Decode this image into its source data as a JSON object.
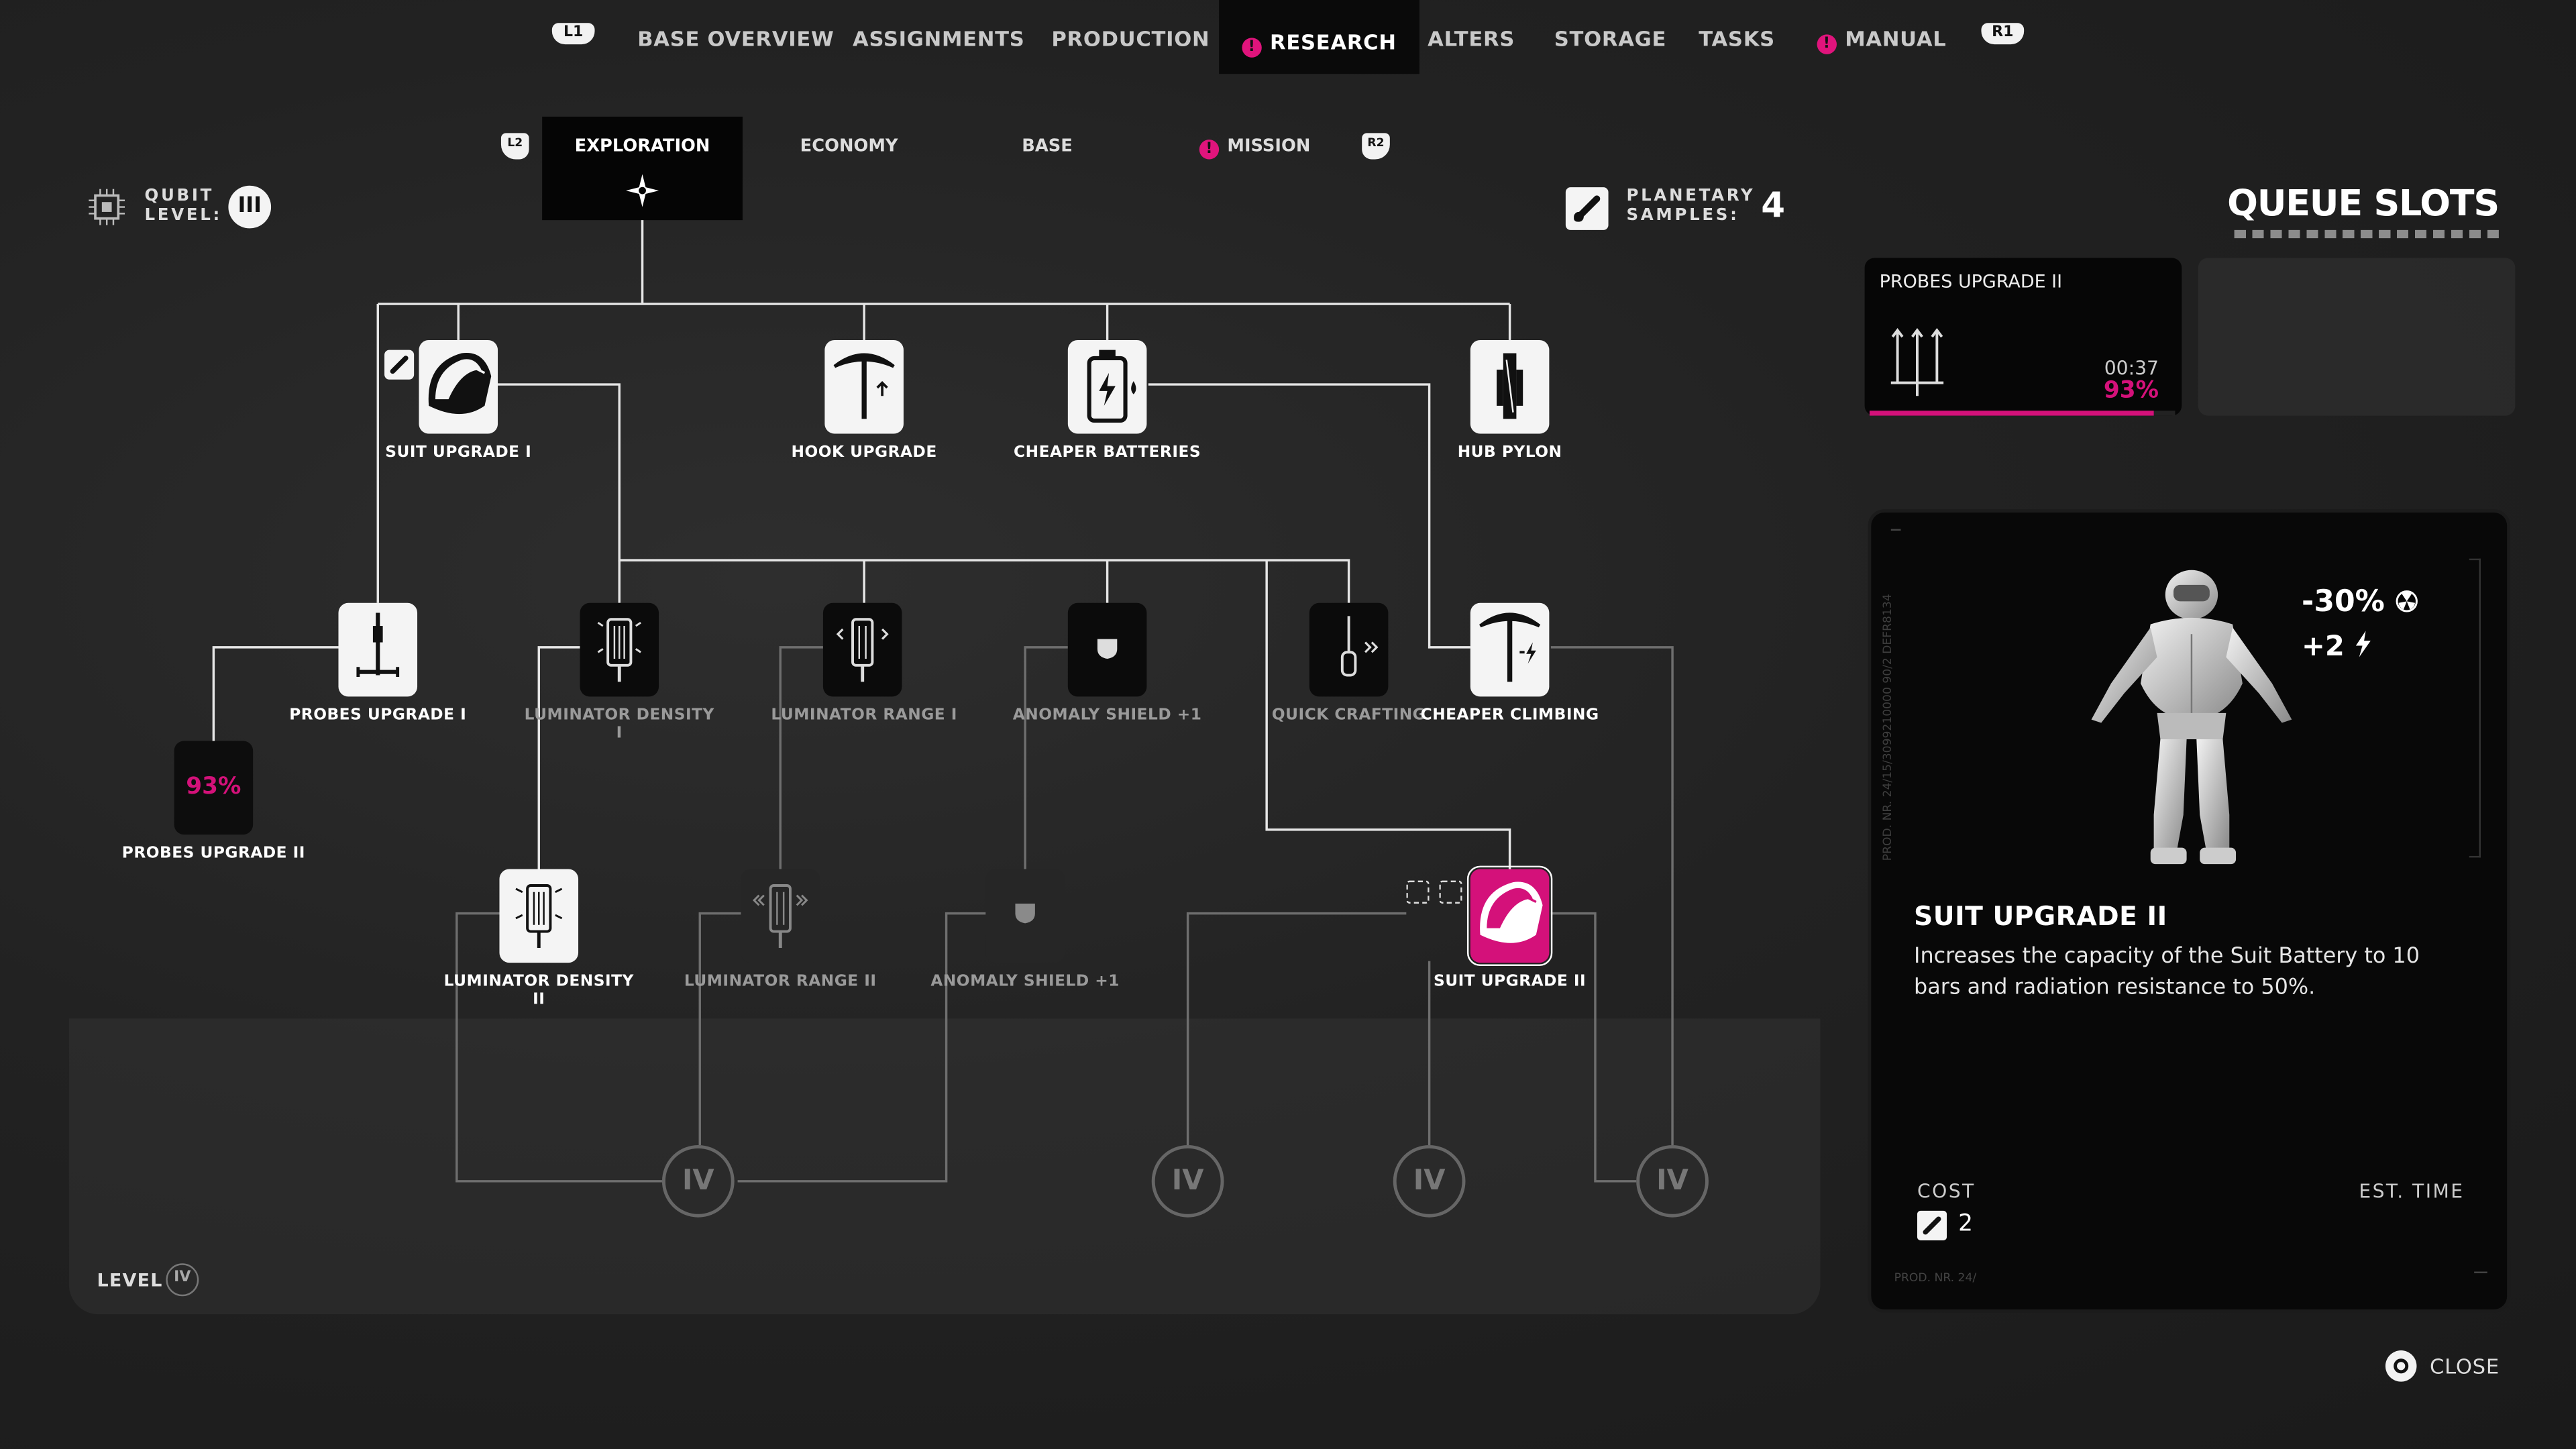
{
  "nav": {
    "left_hint": "L1",
    "right_hint": "R1",
    "tabs": [
      {
        "label": "BASE OVERVIEW",
        "active": false,
        "alert": false
      },
      {
        "label": "ASSIGNMENTS",
        "active": false,
        "alert": false
      },
      {
        "label": "PRODUCTION",
        "active": false,
        "alert": false
      },
      {
        "label": "RESEARCH",
        "active": true,
        "alert": true
      },
      {
        "label": "ALTERS",
        "active": false,
        "alert": false
      },
      {
        "label": "STORAGE",
        "active": false,
        "alert": false
      },
      {
        "label": "TASKS",
        "active": false,
        "alert": false
      },
      {
        "label": "MANUAL",
        "active": false,
        "alert": true
      }
    ],
    "alert_glyph": "!"
  },
  "subnav": {
    "left_hint": "L2",
    "right_hint": "R2",
    "tabs": [
      {
        "label": "EXPLORATION",
        "active": true
      },
      {
        "label": "ECONOMY",
        "active": false
      },
      {
        "label": "BASE",
        "active": false
      },
      {
        "label": "MISSION",
        "active": false,
        "alert": true
      }
    ]
  },
  "qubit": {
    "label_line1": "QUBIT",
    "label_line2": "LEVEL:",
    "value": "III",
    "icon": "chip-icon"
  },
  "samples": {
    "label_line1": "PLANETARY",
    "label_line2": "SAMPLES:",
    "value": "4",
    "icon": "sample-vial-icon"
  },
  "tree": {
    "nodes": [
      {
        "id": "suit-upgrade-1",
        "label": "SUIT UPGRADE I",
        "state": "unlocked",
        "icon": "suit-helmet-icon"
      },
      {
        "id": "hook-upgrade",
        "label": "HOOK UPGRADE",
        "state": "unlocked",
        "icon": "pickaxe-icon"
      },
      {
        "id": "cheaper-batteries",
        "label": "CHEAPER BATTERIES",
        "state": "unlocked",
        "icon": "battery-icon"
      },
      {
        "id": "hub-pylon",
        "label": "HUB PYLON",
        "state": "unlocked",
        "icon": "pylon-icon"
      },
      {
        "id": "probes-upgrade-1",
        "label": "PROBES UPGRADE I",
        "state": "unlocked",
        "icon": "probe-icon"
      },
      {
        "id": "luminator-density-1",
        "label": "LUMINATOR DENSITY I",
        "state": "available",
        "icon": "luminator-icon"
      },
      {
        "id": "luminator-range-1",
        "label": "LUMINATOR RANGE I",
        "state": "available",
        "icon": "luminator-range-icon"
      },
      {
        "id": "anomaly-shield-1",
        "label": "ANOMALY SHIELD +1",
        "state": "available",
        "icon": "shield-icon"
      },
      {
        "id": "quick-crafting",
        "label": "QUICK CRAFTING",
        "state": "available",
        "icon": "screwdriver-icon"
      },
      {
        "id": "cheaper-climbing",
        "label": "CHEAPER CLIMBING",
        "state": "unlocked",
        "icon": "pickaxe-minus-icon"
      },
      {
        "id": "probes-upgrade-2",
        "label": "PROBES UPGRADE II",
        "state": "researching",
        "progress": "93%"
      },
      {
        "id": "luminator-density-2",
        "label": "LUMINATOR DENSITY II",
        "state": "unlocked",
        "icon": "luminator-icon"
      },
      {
        "id": "luminator-range-2",
        "label": "LUMINATOR RANGE II",
        "state": "locked",
        "icon": "luminator-range-icon"
      },
      {
        "id": "anomaly-shield-1b",
        "label": "ANOMALY SHIELD +1",
        "state": "locked",
        "icon": "shield-icon"
      },
      {
        "id": "suit-upgrade-2",
        "label": "SUIT UPGRADE II",
        "state": "selected",
        "icon": "suit-helmet-icon"
      }
    ],
    "level_gates": [
      "IV",
      "IV",
      "IV",
      "IV"
    ],
    "level_label": "LEVEL",
    "level_value": "IV"
  },
  "queue": {
    "title": "QUEUE SLOTS",
    "slots": [
      {
        "name": "PROBES UPGRADE II",
        "time": "00:37",
        "progress": "93%",
        "progress_fraction": 0.93,
        "icon": "probes-icon"
      },
      {
        "name": "",
        "empty": true
      }
    ]
  },
  "detail": {
    "name": "SUIT UPGRADE II",
    "description": "Increases the capacity of the Suit Battery to 10 bars and radiation resistance to 50%.",
    "stat1": "-30%",
    "stat2": "+2",
    "stat1_icon": "radiation-icon",
    "stat2_icon": "lightning-icon",
    "cost_label": "COST",
    "cost_value": "2",
    "time_label": "EST. TIME",
    "serial_side": "PROD. NR. 24/15/3099210000 90/2  DEFR8134",
    "serial_bottom": "PROD. NR. 24/",
    "accent": "#d4117a"
  },
  "close": {
    "label": "CLOSE",
    "icon": "circle-button-icon"
  }
}
